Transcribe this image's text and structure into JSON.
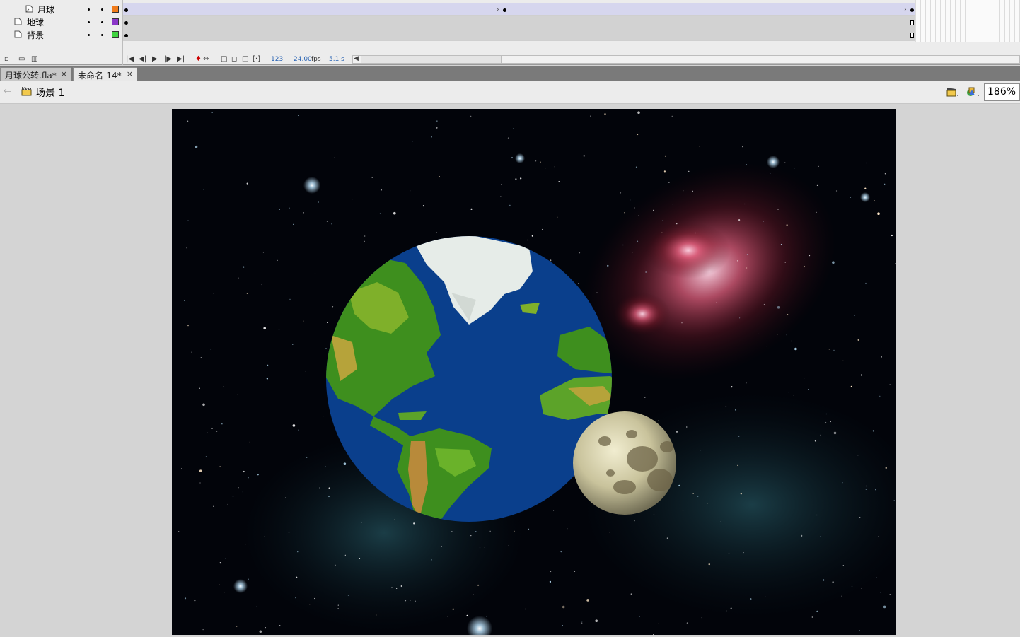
{
  "timeline": {
    "layers": [
      {
        "name": "月球",
        "color": "#f07b1a"
      },
      {
        "name": "地球",
        "color": "#8a36c8"
      },
      {
        "name": "背景",
        "color": "#3fd33f"
      }
    ],
    "controls": {
      "current_frame": "123",
      "fps_value": "24.00",
      "fps_unit": "fps",
      "time": "5.1 s"
    }
  },
  "doc_tabs": [
    {
      "label": "月球公转.fla*",
      "close": "×"
    },
    {
      "label": "未命名-14*",
      "close": "×"
    }
  ],
  "edit_bar": {
    "scene_label": "场景 1",
    "zoom": "186%"
  },
  "colors": {
    "stage_bg": "#02040a",
    "ocean": "#0a3f8c",
    "land": "#3e8f1e",
    "ice": "#e6ece8",
    "moon": "#cfc9a4",
    "playhead": "#cc0000"
  }
}
